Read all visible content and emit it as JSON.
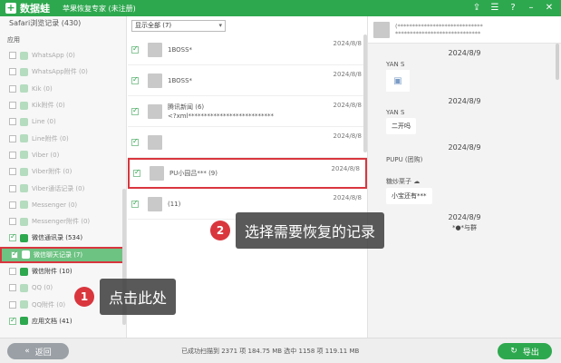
{
  "app": {
    "brand": "数据蛙",
    "title": "苹果恢复专家 (未注册)"
  },
  "sidebar": {
    "top_item": "Safari浏览记录 (430)",
    "section_label": "应用",
    "items": [
      {
        "label": "WhatsApp (0)",
        "checked": false,
        "active": false
      },
      {
        "label": "WhatsApp附件 (0)",
        "checked": false,
        "active": false
      },
      {
        "label": "Kik (0)",
        "checked": false,
        "active": false
      },
      {
        "label": "Kik附件 (0)",
        "checked": false,
        "active": false
      },
      {
        "label": "Line (0)",
        "checked": false,
        "active": false
      },
      {
        "label": "Line附件 (0)",
        "checked": false,
        "active": false
      },
      {
        "label": "Viber (0)",
        "checked": false,
        "active": false
      },
      {
        "label": "Viber附件 (0)",
        "checked": false,
        "active": false
      },
      {
        "label": "Viber通话记录 (0)",
        "checked": false,
        "active": false
      },
      {
        "label": "Messenger (0)",
        "checked": false,
        "active": false
      },
      {
        "label": "Messenger附件 (0)",
        "checked": false,
        "active": false
      },
      {
        "label": "微信通讯录 (534)",
        "checked": true,
        "active": true
      },
      {
        "label": "微信聊天记录 (7)",
        "checked": true,
        "active": true,
        "highlight": true
      },
      {
        "label": "微信附件 (10)",
        "checked": false,
        "active": true
      },
      {
        "label": "QQ (0)",
        "checked": false,
        "active": false
      },
      {
        "label": "QQ附件 (0)",
        "checked": false,
        "active": false
      },
      {
        "label": "应用文档 (41)",
        "checked": true,
        "active": true
      }
    ]
  },
  "list": {
    "filter": "显示全部 (7)",
    "rows": [
      {
        "title": "",
        "sub": "1BOSS*",
        "date": "2024/8/8"
      },
      {
        "title": "",
        "sub": "1BOSS*",
        "date": "2024/8/8"
      },
      {
        "title": "腾讯新闻 (6)",
        "sub": "<?xml***************************",
        "date": "2024/8/8"
      },
      {
        "title": "",
        "sub": "",
        "date": "2024/8/8"
      },
      {
        "title": "PU小园吕*** (9)",
        "sub": "",
        "date": "2024/8/8"
      },
      {
        "title": "(11)",
        "sub": "",
        "date": "2024/8/8"
      }
    ]
  },
  "chat": {
    "header_text": "(*****************************\n*****************************",
    "date1": "2024/8/9",
    "sender1": "YAN S",
    "date2": "2024/8/9",
    "sender2": "YAN S",
    "bubble2": "二开吗",
    "date3": "2024/8/9",
    "sender3": "PUPU (团购)",
    "sender4": "糖炒栗子 ☁",
    "bubble4": "小宝还有***",
    "date4": "2024/8/9",
    "footer_text": "*●*与群"
  },
  "status": {
    "back_label": "返回",
    "text": "已成功扫描到 2371 项 184.75 MB  选中 1158 项 119.11 MB",
    "export_label": "导出"
  },
  "callouts": {
    "one_num": "1",
    "one_text": "点击此处",
    "two_num": "2",
    "two_text": "选择需要恢复的记录"
  },
  "colors": {
    "brand": "#2ea84f",
    "annotation": "#d9363e"
  }
}
